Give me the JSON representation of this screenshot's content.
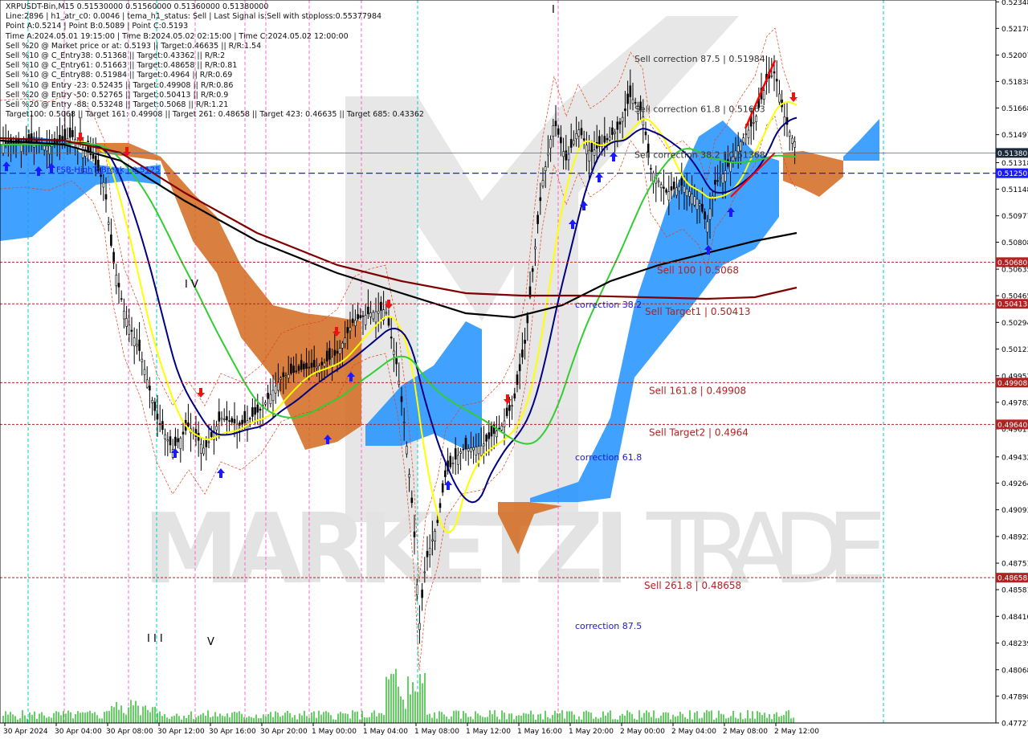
{
  "header": {
    "lines": [
      "XRPUSDT-Bin,M15  0.51530000 0.51560000 0.51360000 0.51380000",
      "Line:2896 | h1_atr_c0: 0.0046 | tema_h1_status: Sell | Last Signal is:Sell with stoploss:0.55377984",
      "Point A:0.5214 | Point B:0.5089 | Point C:0.5193",
      "Time A:2024.05.01 19:15:00 | Time B:2024.05.02 02:15:00 | Time C:2024.05.02 12:00:00",
      "Sell %20 @ Market price or at: 0.5193 || Target:0.46635 || R/R:1.54",
      "Sell %10 @ C_Entry38: 0.51368 || Target:0.43362 || R/R:2",
      "Sell %10 @ C_Entry61: 0.51663 || Target:0.48658 || R/R:0.81",
      "Sell %10 @ C_Entry88: 0.51984 || Target:0.4964 || R/R:0.69",
      "Sell %10 @ Entry -23: 0.52435 || Target:0.49908 || R/R:0.86",
      "Sell %20 @ Entry -50: 0.52765 || Target:0.50413 || R/R:0.9",
      "Sell %20 @ Entry -88: 0.53248 || Target:0.5068 || R/R:1.21",
      "Target100: 0.5068 || Target 161: 0.49908 || Target 261: 0.48658 || Target 423: 0.46635 || Target 685: 0.43362"
    ]
  },
  "watermark": {
    "left": "MARKETZI",
    "right": "TRADE"
  },
  "colors": {
    "background": "#ffffff",
    "cloud_blue": "#1e90ff",
    "cloud_orange": "#d2691e",
    "sell_line": "#b22222",
    "blue_level": "#1a1aff",
    "grid_cyan": "#00cccc",
    "grid_magenta": "#ff66cc",
    "ma_yellow": "#ffff00",
    "ma_navy": "#000080",
    "ma_green": "#32cd32",
    "ma_black": "#000000",
    "ma_maroon": "#800000"
  },
  "chart_data": {
    "type": "line",
    "symbol": "XRPUSDT-Bin",
    "timeframe": "M15",
    "price_axis": {
      "ylim": [
        0.47727,
        0.5236
      ],
      "ticks": [
        "0.52348",
        "0.52178",
        "0.52007",
        "0.51838",
        "0.51668",
        "0.51497",
        "0.51318",
        "0.51148",
        "0.50977",
        "0.50808",
        "0.50635",
        "0.50465",
        "0.50294",
        "0.50123",
        "0.49952",
        "0.49782",
        "0.49611",
        "0.49432",
        "0.49264",
        "0.49093",
        "0.48922",
        "0.48751",
        "0.48581",
        "0.48410",
        "0.48239",
        "0.48068",
        "0.47898",
        "0.47727"
      ]
    },
    "time_axis": {
      "labels": [
        "30 Apr 2024",
        "30 Apr 04:00",
        "30 Apr 08:00",
        "30 Apr 12:00",
        "30 Apr 16:00",
        "30 Apr 20:00",
        "1 May 00:00",
        "1 May 04:00",
        "1 May 08:00",
        "1 May 12:00",
        "1 May 16:00",
        "1 May 20:00",
        "2 May 00:00",
        "2 May 04:00",
        "2 May 08:00",
        "2 May 12:00"
      ]
    },
    "current_price": {
      "value": 0.5138,
      "label": "0.51380"
    },
    "blue_level": {
      "value": 0.5125,
      "label": "0.51250",
      "text": "FSB-HighToBreak | 0.5125"
    },
    "sell_levels": [
      {
        "value": 0.5068,
        "tag": "0.50680",
        "text": "Sell 100 | 0.5068"
      },
      {
        "value": 0.50413,
        "tag": "0.50413",
        "text": "Sell Target1 | 0.50413"
      },
      {
        "value": 0.49908,
        "tag": "0.49908",
        "text": "Sell 161.8 | 0.49908"
      },
      {
        "value": 0.4964,
        "tag": "0.49640",
        "text": "Sell Target2 | 0.4964"
      },
      {
        "value": 0.48658,
        "tag": "0.48658",
        "text": "Sell 261.8 | 0.48658"
      }
    ],
    "correction_labels": [
      {
        "text": "Sell correction 87.5 | 0.51984",
        "value": 0.51984
      },
      {
        "text": "Sell correction 61.8 | 0.51663",
        "value": 0.51663
      },
      {
        "text": "Sell correction 38.2 | 0.51368",
        "value": 0.51368
      },
      {
        "text": "correction 38.2",
        "value": 0.5041
      },
      {
        "text": "correction 61.8",
        "value": 0.4943
      },
      {
        "text": "correction 87.5",
        "value": 0.4835
      }
    ],
    "wave_labels": [
      "I",
      "I V",
      "I I I",
      "V"
    ],
    "ohlc": {
      "open": 0.5153,
      "high": 0.5156,
      "low": 0.5136,
      "close": 0.5138
    },
    "grid": false
  }
}
